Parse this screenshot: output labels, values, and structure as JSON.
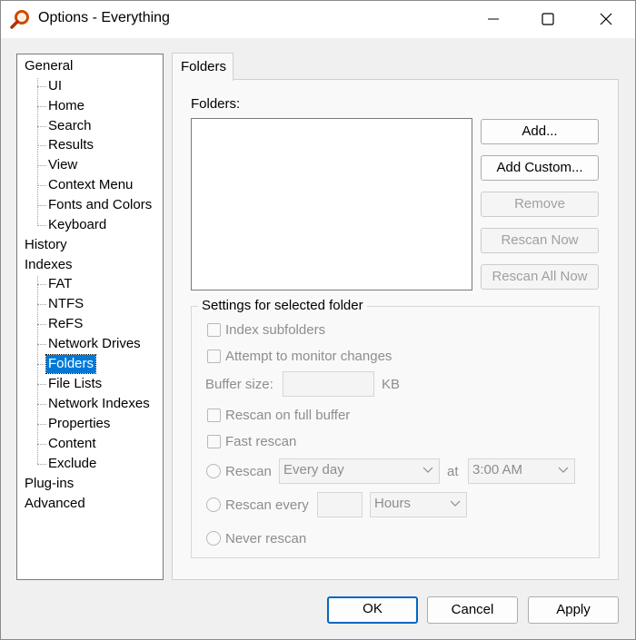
{
  "window": {
    "title": "Options - Everything",
    "minimize_icon": "minimize-icon",
    "maximize_icon": "maximize-icon",
    "close_icon": "close-icon"
  },
  "tree": {
    "general": "General",
    "ui": "UI",
    "home": "Home",
    "search": "Search",
    "results": "Results",
    "view": "View",
    "context_menu": "Context Menu",
    "fonts_colors": "Fonts and Colors",
    "keyboard": "Keyboard",
    "history": "History",
    "indexes": "Indexes",
    "fat": "FAT",
    "ntfs": "NTFS",
    "refs": "ReFS",
    "network_drives": "Network Drives",
    "folders": "Folders",
    "file_lists": "File Lists",
    "network_indexes": "Network Indexes",
    "properties": "Properties",
    "content": "Content",
    "exclude": "Exclude",
    "plugins": "Plug-ins",
    "advanced": "Advanced",
    "selected": "Folders"
  },
  "tab": {
    "label": "Folders"
  },
  "folders_label": "Folders:",
  "buttons": {
    "add": "Add...",
    "add_custom": "Add Custom...",
    "remove": "Remove",
    "rescan_now": "Rescan Now",
    "rescan_all_now": "Rescan All Now"
  },
  "settings": {
    "group_label": "Settings for selected folder",
    "index_subfolders": "Index subfolders",
    "attempt_monitor": "Attempt to monitor changes",
    "buffer_size_label": "Buffer size:",
    "buffer_unit": "KB",
    "rescan_full_buffer": "Rescan on full buffer",
    "fast_rescan": "Fast rescan",
    "rescan_label": "Rescan",
    "rescan_frequency": "Every day",
    "at_label": "at",
    "rescan_time": "3:00 AM",
    "rescan_every_label": "Rescan every",
    "rescan_every_unit": "Hours",
    "never_rescan": "Never rescan"
  },
  "footer": {
    "ok": "OK",
    "cancel": "Cancel",
    "apply": "Apply"
  }
}
